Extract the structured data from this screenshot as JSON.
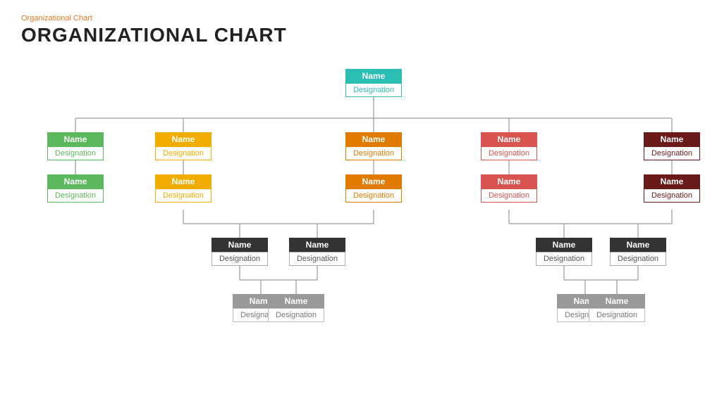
{
  "page": {
    "subtitle": "Organizational  Chart",
    "title": "ORGANIZATIONAL CHART"
  },
  "nodes": {
    "root": {
      "name": "Name",
      "designation": "Designation"
    },
    "l1_1": {
      "name": "Name",
      "designation": "Designation"
    },
    "l1_2": {
      "name": "Name",
      "designation": "Designation"
    },
    "l1_3": {
      "name": "Name",
      "designation": "Designation"
    },
    "l1_4": {
      "name": "Name",
      "designation": "Designation"
    },
    "l1_5": {
      "name": "Name",
      "designation": "Designation"
    },
    "l2_1": {
      "name": "Name",
      "designation": "Designation"
    },
    "l2_2": {
      "name": "Name",
      "designation": "Designation"
    },
    "l2_3": {
      "name": "Name",
      "designation": "Designation"
    },
    "l2_4": {
      "name": "Name",
      "designation": "Designation"
    },
    "l2_5": {
      "name": "Name",
      "designation": "Designation"
    },
    "l3_1": {
      "name": "Name",
      "designation": "Designation"
    },
    "l3_2": {
      "name": "Name",
      "designation": "Designation"
    },
    "l3_3": {
      "name": "Name",
      "designation": "Designation"
    },
    "l3_4": {
      "name": "Name",
      "designation": "Designation"
    },
    "l4_1": {
      "name": "Name",
      "designation": "Designation"
    },
    "l4_2": {
      "name": "Name",
      "designation": "Designation"
    },
    "l4_3": {
      "name": "Name",
      "designation": "Designation"
    },
    "l4_4": {
      "name": "Name",
      "designation": "Designation"
    }
  }
}
